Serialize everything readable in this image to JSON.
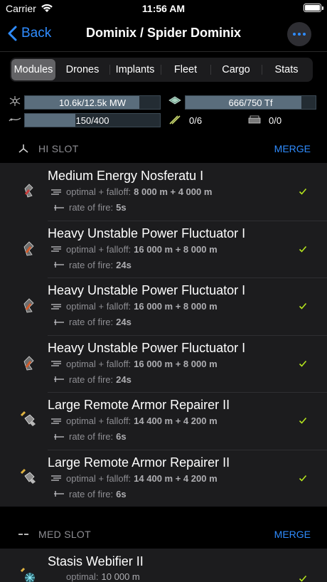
{
  "status_bar": {
    "carrier": "Carrier",
    "time": "11:56 AM"
  },
  "nav": {
    "back_label": "Back",
    "title": "Dominix / Spider Dominix"
  },
  "tabs": [
    {
      "label": "Modules",
      "active": true
    },
    {
      "label": "Drones",
      "active": false
    },
    {
      "label": "Implants",
      "active": false
    },
    {
      "label": "Fleet",
      "active": false
    },
    {
      "label": "Cargo",
      "active": false
    },
    {
      "label": "Stats",
      "active": false
    }
  ],
  "resources": {
    "powergrid": {
      "text": "10.6k/12.5k MW",
      "fraction": 0.848,
      "icon": "powergrid-icon"
    },
    "cpu": {
      "text": "666/750 Tf",
      "fraction": 0.888,
      "icon": "cpu-icon"
    },
    "calibration": {
      "text": "150/400",
      "fraction": 0.375,
      "icon": "calibration-icon"
    },
    "turret_hardpoints": {
      "text": "0/6",
      "icon": "turret-icon"
    },
    "launcher_hardpoints": {
      "text": "0/0",
      "icon": "launcher-icon"
    }
  },
  "hi_slot": {
    "label": "HI SLOT",
    "merge_label": "MERGE",
    "modules": [
      {
        "name": "Medium Energy Nosferatu I",
        "line1_label": "optimal + falloff:",
        "line1_value": "8 000 m + 4 000 m",
        "line2_label": "rate of fire:",
        "line2_value": "5s",
        "icon": "nosferatu-icon"
      },
      {
        "name": "Heavy Unstable Power Fluctuator I",
        "line1_label": "optimal + falloff:",
        "line1_value": "16 000 m + 8 000 m",
        "line2_label": "rate of fire:",
        "line2_value": "24s",
        "icon": "fluctuator-icon"
      },
      {
        "name": "Heavy Unstable Power Fluctuator I",
        "line1_label": "optimal + falloff:",
        "line1_value": "16 000 m + 8 000 m",
        "line2_label": "rate of fire:",
        "line2_value": "24s",
        "icon": "fluctuator-icon"
      },
      {
        "name": "Heavy Unstable Power Fluctuator I",
        "line1_label": "optimal + falloff:",
        "line1_value": "16 000 m + 8 000 m",
        "line2_label": "rate of fire:",
        "line2_value": "24s",
        "icon": "fluctuator-icon"
      },
      {
        "name": "Large Remote Armor Repairer II",
        "line1_label": "optimal + falloff:",
        "line1_value": "14 400 m + 4 200 m",
        "line2_label": "rate of fire:",
        "line2_value": "6s",
        "icon": "armor-repairer-icon"
      },
      {
        "name": "Large Remote Armor Repairer II",
        "line1_label": "optimal + falloff:",
        "line1_value": "14 400 m + 4 200 m",
        "line2_label": "rate of fire:",
        "line2_value": "6s",
        "icon": "armor-repairer-icon"
      }
    ]
  },
  "med_slot": {
    "label": "MED SLOT",
    "merge_label": "MERGE",
    "modules": [
      {
        "name": "Stasis Webifier II",
        "line1_label": "optimal:",
        "line1_value": "10 000 m",
        "icon": "webifier-icon"
      }
    ]
  },
  "colors": {
    "accent": "#2f8cff",
    "check": "#b5e61d",
    "row_bg": "#1c1c1e"
  }
}
